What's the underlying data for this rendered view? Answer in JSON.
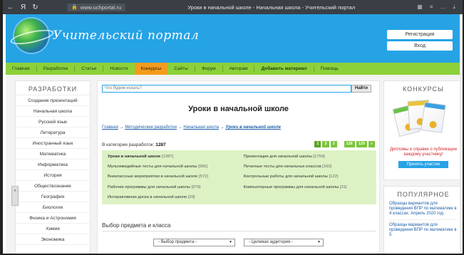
{
  "browser": {
    "nav": [
      "←",
      "Я",
      "↻"
    ],
    "url": "www.uchportal.ru",
    "title": "Уроки в начальной школе - Начальная школа - Учительский портал",
    "icons": [
      "▦",
      "≡",
      "…",
      "⤓"
    ]
  },
  "header": {
    "logo_text": "Учительский портал",
    "register": "Регистрация",
    "login": "Вход"
  },
  "menu": [
    "Главная",
    "Разработки",
    "Статьи",
    "Новости",
    "Конкурсы",
    "Сайты",
    "Форум",
    "Авторам",
    "Добавить материал",
    "Помощь"
  ],
  "menu_active": "Конкурсы",
  "sidebar": {
    "title": "РАЗРАБОТКИ",
    "items": [
      "Создание презентаций",
      "Начальная школа",
      "Русский язык",
      "Литература",
      "Иностранный язык",
      "Математика",
      "Информатика",
      "История",
      "Обществознание",
      "География",
      "Биология",
      "Физика и Астрономия",
      "Химия",
      "Экономика"
    ],
    "tab": "»"
  },
  "search": {
    "placeholder": "Что будем искать?",
    "button": "Найти"
  },
  "main": {
    "title": "Уроки в начальной школе",
    "crumbs": [
      "Главная",
      "Методические разработки",
      "Начальная школа",
      "Уроки в начальной школе"
    ],
    "count_label": "В категории разработок:",
    "count_value": "1287",
    "pager": [
      "1",
      "2",
      "3",
      "128",
      "129",
      "»"
    ],
    "categories": [
      {
        "name": "Уроки в начальной школе",
        "count": "[1287]",
        "bold": true
      },
      {
        "name": "Презентации для начальной школы",
        "count": "[1759]",
        "bold": false
      },
      {
        "name": "Мультимедийные тесты для начальной школы",
        "count": "[666]",
        "bold": false
      },
      {
        "name": "Печатные тесты для начальных классов",
        "count": "[160]",
        "bold": false
      },
      {
        "name": "Внеклассные мероприятия в начальной школе",
        "count": "[572]",
        "bold": false
      },
      {
        "name": "Контрольные работы для начальной школы",
        "count": "[122]",
        "bold": false
      },
      {
        "name": "Рабочие программы для начальной школы",
        "count": "[376]",
        "bold": false
      },
      {
        "name": "Компьютерные программы для начальной школы",
        "count": "[31]",
        "bold": false
      },
      {
        "name": "Интерактивная доска в начальной школе",
        "count": "[20]",
        "bold": false
      }
    ],
    "subject_title": "Выбор предмета и класса",
    "select_subject": "- Выбор предмета -",
    "select_audience": "- Целевая аудитория -"
  },
  "right": {
    "contests_title": "КОНКУРСЫ",
    "contests_text": "Дипломы и справки о публикации каждому участнику!",
    "contests_button": "Принять участие",
    "popular_title": "ПОПУЛЯРНОЕ",
    "popular_items": [
      "Образцы вариантов для проведения ВПР по математике в 4 классах. Апрель 2020 год",
      "Образцы вариантов для проведения ВПР по математике в 5"
    ]
  },
  "colors": {
    "header": "#26a3e5",
    "menu": "#8cd13a",
    "active": "#f39c1e",
    "catbox": "#dcf2c4"
  }
}
